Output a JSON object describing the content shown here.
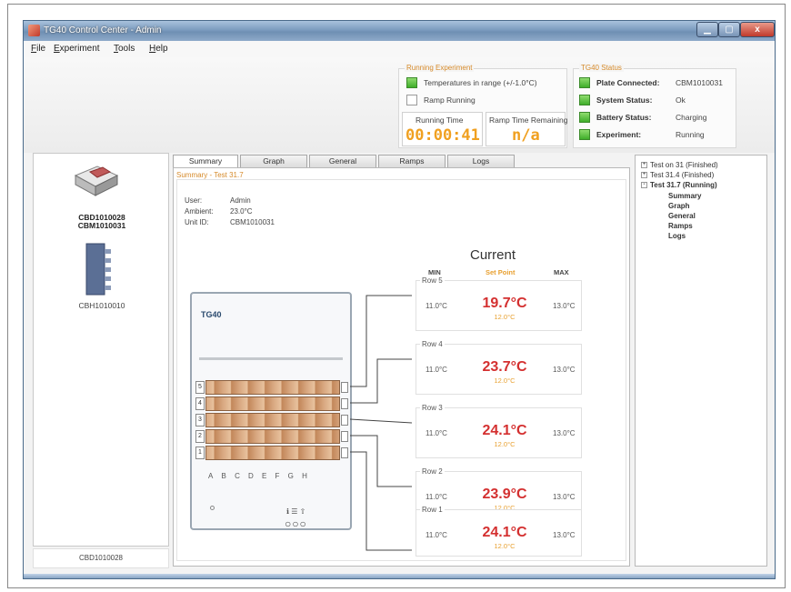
{
  "window": {
    "title": "TG40 Control Center - Admin",
    "close_symbol": "x"
  },
  "menu": {
    "items": [
      "File",
      "Experiment",
      "Tools",
      "Help"
    ]
  },
  "running_experiment": {
    "group_title": "Running Experiment",
    "temp_in_range": "Temperatures in range (+/-1.0°C)",
    "ramp_running": "Ramp Running",
    "running_time_label": "Running Time",
    "running_time": "00:00:41",
    "ramp_remaining_label": "Ramp Time Remaining",
    "ramp_remaining": "n/a"
  },
  "status": {
    "group_title": "TG40 Status",
    "plate_label": "Plate Connected:",
    "plate_value": "CBM1010031",
    "system_label": "System Status:",
    "system_value": "Ok",
    "battery_label": "Battery Status:",
    "battery_value": "Charging",
    "experiment_label": "Experiment:",
    "experiment_value": "Running"
  },
  "left": {
    "device1_line1": "CBD1010028",
    "device1_line2": "CBM1010031",
    "device2_label": "CBH1010010",
    "footer": "CBD1010028"
  },
  "tabs": [
    "Summary",
    "Graph",
    "General",
    "Ramps",
    "Logs"
  ],
  "summary": {
    "title": "Summary - Test 31.7",
    "user_label": "User:",
    "user_value": "Admin",
    "ambient_label": "Ambient:",
    "ambient_value": "23.0°C",
    "unit_label": "Unit ID:",
    "unit_value": "CBM1010031"
  },
  "plate": {
    "title": "TG40",
    "rows": [
      "5",
      "4",
      "3",
      "2",
      "1"
    ],
    "columns": "ABCDEFGH",
    "icon_glyphs": "ℹ ☰ ⇧",
    "circle_glyphs": "○○○"
  },
  "current": {
    "heading": "Current",
    "min_label": "MIN",
    "sp_label": "Set Point",
    "max_label": "MAX",
    "rows": [
      {
        "label": "Row 5",
        "min": "11.0°C",
        "temp": "19.7°C",
        "setpoint": "12.0°C",
        "max": "13.0°C"
      },
      {
        "label": "Row 4",
        "min": "11.0°C",
        "temp": "23.7°C",
        "setpoint": "12.0°C",
        "max": "13.0°C"
      },
      {
        "label": "Row 3",
        "min": "11.0°C",
        "temp": "24.1°C",
        "setpoint": "12.0°C",
        "max": "13.0°C"
      },
      {
        "label": "Row 2",
        "min": "11.0°C",
        "temp": "23.9°C",
        "setpoint": "12.0°C",
        "max": "13.0°C"
      },
      {
        "label": "Row 1",
        "min": "11.0°C",
        "temp": "24.1°C",
        "setpoint": "12.0°C",
        "max": "13.0°C"
      }
    ]
  },
  "tree": {
    "items": [
      {
        "text": "Test on 31 (Finished)",
        "expander": "+"
      },
      {
        "text": "Test 31.4 (Finished)",
        "expander": "+"
      },
      {
        "text": "Test 31.7 (Running)",
        "expander": "-"
      },
      {
        "text": "Summary"
      },
      {
        "text": "Graph"
      },
      {
        "text": "General"
      },
      {
        "text": "Ramps"
      },
      {
        "text": "Logs"
      }
    ]
  },
  "colors": {
    "accent_orange": "#e8a030",
    "temp_red": "#d43030",
    "check_green": "#3fae2a"
  }
}
